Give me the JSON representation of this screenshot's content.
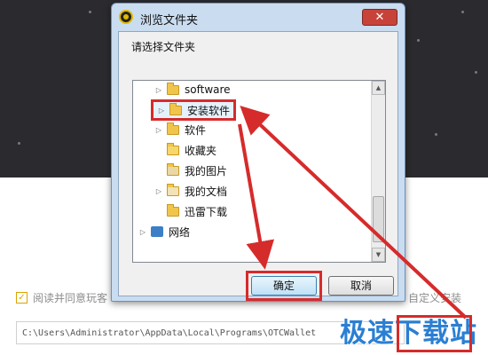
{
  "background": {
    "agree_text": "阅读并同意玩客",
    "custom_install": "自定义安装",
    "install_path": "C:\\Users\\Administrator\\AppData\\Local\\Programs\\OTCWallet",
    "watermark": "极速下载站"
  },
  "dialog": {
    "title": "浏览文件夹",
    "close_glyph": "✕",
    "prompt": "请选择文件夹",
    "tree_items": [
      {
        "label": "software",
        "arrow": "▷",
        "icon": "folder"
      },
      {
        "label": "安装软件",
        "arrow": "▷",
        "icon": "folder",
        "selected": true
      },
      {
        "label": "软件",
        "arrow": "▷",
        "icon": "folder"
      },
      {
        "label": "收藏夹",
        "arrow": "",
        "icon": "star-folder"
      },
      {
        "label": "我的图片",
        "arrow": "",
        "icon": "picture-folder"
      },
      {
        "label": "我的文档",
        "arrow": "▷",
        "icon": "document-folder"
      },
      {
        "label": "迅雷下载",
        "arrow": "",
        "icon": "folder"
      },
      {
        "label": "网络",
        "arrow": "▷",
        "icon": "network-icon"
      }
    ],
    "ok_label": "确定",
    "cancel_label": "取消"
  },
  "colors": {
    "annotation_red": "#d62b2b",
    "watermark_blue": "#2a7fd3",
    "checkbox_gold": "#d9a400"
  }
}
